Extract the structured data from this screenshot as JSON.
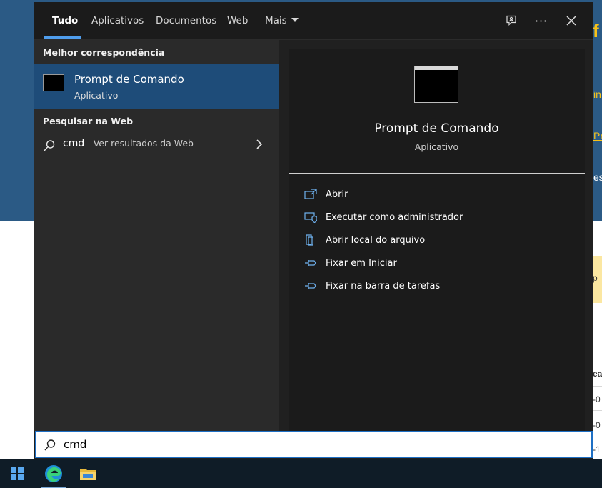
{
  "tabs": [
    {
      "label": "Tudo",
      "active": true
    },
    {
      "label": "Aplicativos"
    },
    {
      "label": "Documentos"
    },
    {
      "label": "Web"
    },
    {
      "label": "Mais"
    }
  ],
  "left": {
    "best_heading": "Melhor correspondência",
    "best": {
      "title": "Prompt de Comando",
      "subtitle": "Aplicativo",
      "icon": "command-prompt-icon"
    },
    "web_heading": "Pesquisar na Web",
    "web_item": {
      "query": "cmd",
      "suffix": " - Ver resultados da Web"
    }
  },
  "right": {
    "title": "Prompt de Comando",
    "subtitle": "Aplicativo",
    "actions": [
      {
        "label": "Abrir",
        "icon": "open-icon"
      },
      {
        "label": "Executar como administrador",
        "icon": "shield-admin-icon"
      },
      {
        "label": "Abrir local do arquivo",
        "icon": "file-location-icon"
      },
      {
        "label": "Fixar em Iniciar",
        "icon": "pin-icon"
      },
      {
        "label": "Fixar na barra de tarefas",
        "icon": "pin-icon"
      }
    ]
  },
  "search": {
    "value": "cmd"
  },
  "background": {
    "fragments": [
      "f",
      "in",
      "Pre",
      "es",
      "p",
      "ea",
      "-0",
      "-0",
      "-1"
    ]
  },
  "colors": {
    "accent": "#4f9dec",
    "selection": "#1e4c79",
    "menu_bg": "#202020",
    "taskbar": "#0f1c27"
  }
}
